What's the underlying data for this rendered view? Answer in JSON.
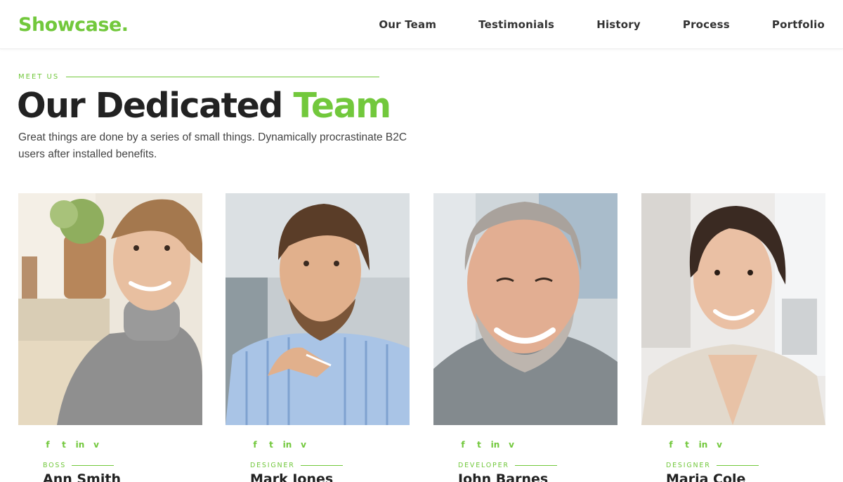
{
  "brand": {
    "logo": "Showcase.",
    "accent_color": "#72c83c"
  },
  "nav": {
    "items": [
      {
        "label": "Our Team"
      },
      {
        "label": "Testimonials"
      },
      {
        "label": "History"
      },
      {
        "label": "Process"
      },
      {
        "label": "Portfolio"
      }
    ]
  },
  "section": {
    "eyebrow": "MEET US",
    "title_main": "Our Dedicated",
    "title_accent": "Team",
    "intro": "Great things are done by a series of small things. Dynamically procrastinate B2C users after installed benefits."
  },
  "social_icons": [
    "facebook-icon",
    "twitter-icon",
    "linkedin-icon",
    "vine-icon"
  ],
  "team": [
    {
      "role": "BOSS",
      "name": "Ann Smith"
    },
    {
      "role": "DESIGNER",
      "name": "Mark Jones"
    },
    {
      "role": "DEVELOPER",
      "name": "John Barnes"
    },
    {
      "role": "DESIGNER",
      "name": "Maria Cole"
    }
  ]
}
